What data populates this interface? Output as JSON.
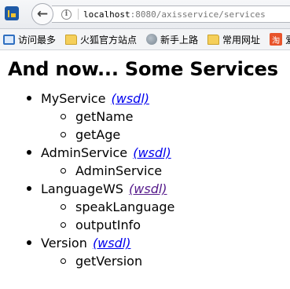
{
  "browser": {
    "url_host": "localhost",
    "url_rest": ":8080/axisservice/services",
    "bookmarks": [
      {
        "label": "访问最多",
        "icon": "bookmark-list-icon"
      },
      {
        "label": "火狐官方站点",
        "icon": "folder-icon"
      },
      {
        "label": "新手上路",
        "icon": "globe-icon"
      },
      {
        "label": "常用网址",
        "icon": "folder-icon"
      },
      {
        "label": "爱",
        "icon": "taobao-icon",
        "icon_text": "淘"
      }
    ]
  },
  "page": {
    "heading": "And now... Some Services",
    "wsdl_label": "(wsdl)",
    "services": [
      {
        "name": "MyService",
        "link": "(wsdl)",
        "operations": [
          "getName",
          "getAge"
        ]
      },
      {
        "name": "AdminService",
        "link": "(wsdl)",
        "operations": [
          "AdminService"
        ]
      },
      {
        "name": "LanguageWS",
        "link": "(wsdl)",
        "operations": [
          "speakLanguage",
          "outputInfo"
        ]
      },
      {
        "name": "Version",
        "link": "(wsdl)",
        "operations": [
          "getVersion"
        ]
      }
    ]
  }
}
